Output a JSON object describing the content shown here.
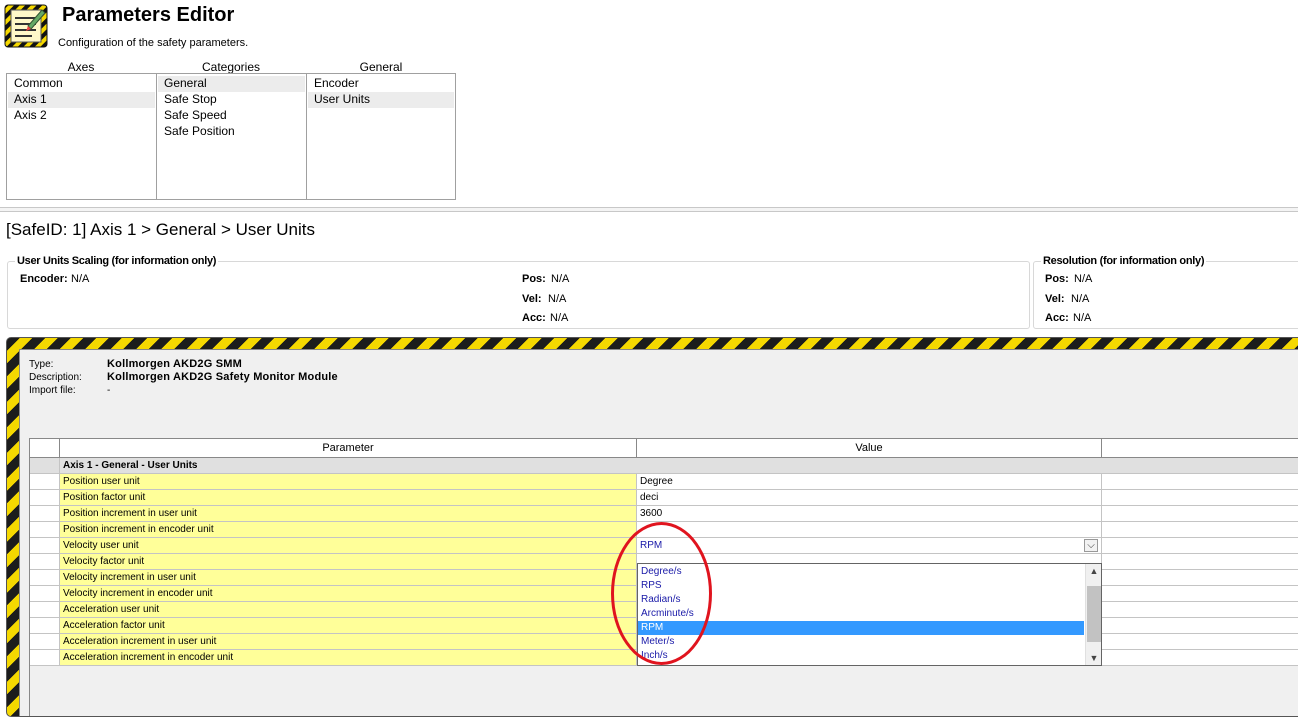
{
  "header": {
    "title": "Parameters Editor",
    "subtitle": "Configuration of the safety parameters.",
    "icon": "checklist-hazard-icon"
  },
  "axes": {
    "header": "Axes",
    "items": [
      "Common",
      "Axis 1",
      "Axis 2"
    ],
    "selected": "Axis 1"
  },
  "categories": {
    "header": "Categories",
    "items": [
      "General",
      "Safe Stop",
      "Safe Speed",
      "Safe Position"
    ],
    "selected": "General"
  },
  "general": {
    "header": "General",
    "items": [
      "Encoder",
      "User Units"
    ],
    "selected": "User Units"
  },
  "breadcrumb": "[SafeID: 1]  Axis 1 > General > User Units",
  "scaling": {
    "title": "User Units Scaling (for information only)",
    "encoder_label": "Encoder:",
    "encoder_value": "N/A",
    "pos_label": "Pos:",
    "pos_value": "N/A",
    "vel_label": "Vel:",
    "vel_value": "N/A",
    "acc_label": "Acc:",
    "acc_value": "N/A"
  },
  "resolution": {
    "title": "Resolution (for information only)",
    "pos_label": "Pos:",
    "pos_value": "N/A",
    "vel_label": "Vel:",
    "vel_value": "N/A",
    "acc_label": "Acc:",
    "acc_value": "N/A"
  },
  "device": {
    "type_label": "Type:",
    "type_value": "Kollmorgen AKD2G SMM",
    "description_label": "Description:",
    "description_value": "Kollmorgen AKD2G Safety Monitor Module",
    "import_label": "Import file:",
    "import_value": "-"
  },
  "grid": {
    "col_parameter": "Parameter",
    "col_value": "Value",
    "group_title": "Axis 1 - General - User Units",
    "rows": [
      {
        "parameter": "Position user unit",
        "value": "Degree"
      },
      {
        "parameter": "Position factor unit",
        "value": "deci"
      },
      {
        "parameter": "Position increment in user unit",
        "value": "3600"
      },
      {
        "parameter": "Position increment in encoder unit",
        "value": ""
      },
      {
        "parameter": "Velocity user unit",
        "value": "RPM"
      },
      {
        "parameter": "Velocity factor unit",
        "value": ""
      },
      {
        "parameter": "Velocity increment in user unit",
        "value": ""
      },
      {
        "parameter": "Velocity increment in encoder unit",
        "value": ""
      },
      {
        "parameter": "Acceleration user unit",
        "value": ""
      },
      {
        "parameter": "Acceleration factor unit",
        "value": ""
      },
      {
        "parameter": "Acceleration increment in user unit",
        "value": ""
      },
      {
        "parameter": "Acceleration increment in encoder unit",
        "value": ""
      }
    ]
  },
  "dropdown": {
    "current": "RPM",
    "options": [
      "Degree/s",
      "RPS",
      "Radian/s",
      "Arcminute/s",
      "RPM",
      "Meter/s",
      "Inch/s"
    ],
    "selected": "RPM"
  },
  "colors": {
    "parameter_cell": "#ffff99",
    "selection": "#3399ff",
    "hazard_yellow": "#f5d800",
    "hazard_black": "#1c1c1c",
    "annotation": "#e0141e"
  }
}
